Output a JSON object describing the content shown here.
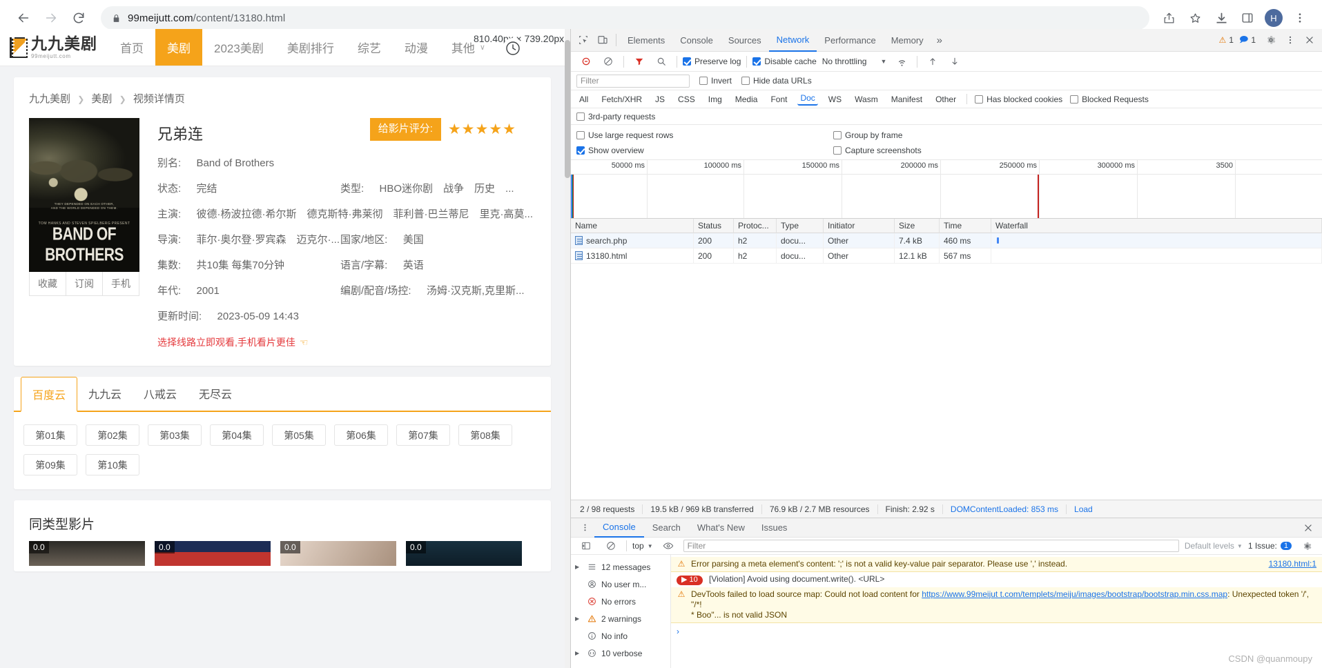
{
  "browser": {
    "url_main": "99meijutt.com",
    "url_path": "/content/13180.html",
    "back_icon": "back-arrow-icon",
    "forward_icon": "forward-arrow-icon",
    "reload_icon": "reload-icon",
    "lock_icon": "lock-icon",
    "share_icon": "share-icon",
    "bookmark_icon": "star-icon",
    "download_icon": "download-icon",
    "sidepanel_icon": "side-panel-icon",
    "profile_initial": "H",
    "menu_icon": "kebab-menu-icon"
  },
  "site": {
    "logo_cn": "九九美剧",
    "logo_en": "99meijutt.com",
    "nav": [
      {
        "label": "首页",
        "active": false
      },
      {
        "label": "美剧",
        "active": true
      },
      {
        "label": "2023美剧",
        "active": false
      },
      {
        "label": "美剧排行",
        "active": false
      },
      {
        "label": "综艺",
        "active": false
      },
      {
        "label": "动漫",
        "active": false
      },
      {
        "label": "其他",
        "active": false,
        "caret": "∨"
      }
    ]
  },
  "overlay": {
    "dimension_label": "810.40px × 739.20px",
    "clock_icon": "clock-icon"
  },
  "detail": {
    "breadcrumb": [
      "九九美剧",
      "美剧",
      "视频详情页"
    ],
    "breadcrumb_sep": "❯",
    "poster": {
      "tagline_1": "THEY DEPENDED ON EACH OTHER,",
      "tagline_2": "AND THE WORLD DEPENDED ON THEM.",
      "presents": "TOM HANKS AND STEVEN SPIELBERG PRESENT",
      "title": "BAND OF BROTHERS"
    },
    "poster_buttons": [
      "收藏",
      "订阅",
      "手机"
    ],
    "title": "兄弟连",
    "rating_label": "给影片评分:",
    "stars": "★★★★★",
    "rows": [
      {
        "left_key": "别名:",
        "left_val": "Band of Brothers",
        "full": true
      },
      {
        "left_key": "状态:",
        "left_val": "完结",
        "right_key": "类型:",
        "right_val": "HBO迷你剧　战争　历史　..."
      },
      {
        "left_key": "主演:",
        "left_val": "彼德·杨波拉德·希尔斯　德克斯特·弗莱彻　菲利普·巴兰蒂尼　里克·高莫...",
        "full": true
      },
      {
        "left_key": "导演:",
        "left_val": "菲尔·奥尔登·罗宾森　迈克尔·...",
        "right_key": "国家/地区:",
        "right_val": "美国"
      },
      {
        "left_key": "集数:",
        "left_val": "共10集 每集70分钟",
        "right_key": "语言/字幕:",
        "right_val": "英语"
      },
      {
        "left_key": "年代:",
        "left_val": "2001",
        "right_key": "编剧/配音/场控:",
        "right_val": "汤姆·汉克斯,克里斯..."
      }
    ],
    "update_key": "更新时间:",
    "update_val": "2023-05-09 14:43",
    "red_link": "选择线路立即观看,手机看片更佳",
    "hand_icon": "pointing-hand-icon"
  },
  "sources": {
    "tabs": [
      {
        "label": "百度云",
        "active": true
      },
      {
        "label": "九九云",
        "active": false
      },
      {
        "label": "八戒云",
        "active": false
      },
      {
        "label": "无尽云",
        "active": false
      }
    ],
    "episodes": [
      "第01集",
      "第02集",
      "第03集",
      "第04集",
      "第05集",
      "第06集",
      "第07集",
      "第08集",
      "第09集",
      "第10集"
    ]
  },
  "similar": {
    "title": "同类型影片",
    "items": [
      {
        "score": "0.0"
      },
      {
        "score": "0.0"
      },
      {
        "score": "0.0"
      },
      {
        "score": "0.0"
      }
    ]
  },
  "devtools": {
    "inspect_icon": "inspect-element-icon",
    "device_icon": "device-toolbar-icon",
    "tabs": [
      {
        "label": "Elements",
        "active": false
      },
      {
        "label": "Console",
        "active": false
      },
      {
        "label": "Sources",
        "active": false
      },
      {
        "label": "Network",
        "active": true
      },
      {
        "label": "Performance",
        "active": false
      },
      {
        "label": "Memory",
        "active": false
      }
    ],
    "more_tabs": "»",
    "warning_count": "1",
    "info_count": "1",
    "settings_icon": "gear-icon",
    "kebab_icon": "kebab-menu-icon",
    "close_icon": "close-icon",
    "network": {
      "record_icon": "record-stop-icon",
      "clear_icon": "clear-icon",
      "filter_icon": "filter-icon",
      "search_icon": "search-icon",
      "preserve_log": "Preserve log",
      "preserve_log_checked": true,
      "disable_cache": "Disable cache",
      "disable_cache_checked": true,
      "throttling": "No throttling",
      "wifi_icon": "wifi-icon",
      "import_icon": "import-har-icon",
      "export_icon": "export-har-icon",
      "filter_placeholder": "Filter",
      "invert": "Invert",
      "hide_data_urls": "Hide data URLs",
      "types": [
        "All",
        "Fetch/XHR",
        "JS",
        "CSS",
        "Img",
        "Media",
        "Font",
        "Doc",
        "WS",
        "Wasm",
        "Manifest",
        "Other"
      ],
      "active_type": "Doc",
      "has_blocked_cookies": "Has blocked cookies",
      "blocked_requests": "Blocked Requests",
      "third_party": "3rd-party requests",
      "large_rows": "Use large request rows",
      "group_by_frame": "Group by frame",
      "show_overview": "Show overview",
      "show_overview_checked": true,
      "capture_screenshots": "Capture screenshots",
      "overview_ticks": [
        "50000 ms",
        "100000 ms",
        "150000 ms",
        "200000 ms",
        "250000 ms",
        "300000 ms",
        "3500"
      ],
      "columns": [
        "Name",
        "Status",
        "Protoc...",
        "Type",
        "Initiator",
        "Size",
        "Time",
        "Waterfall"
      ],
      "rows": [
        {
          "name": "search.php",
          "status": "200",
          "protocol": "h2",
          "type": "docu...",
          "initiator": "Other",
          "size": "7.4 kB",
          "time": "460 ms"
        },
        {
          "name": "13180.html",
          "status": "200",
          "protocol": "h2",
          "type": "docu...",
          "initiator": "Other",
          "size": "12.1 kB",
          "time": "567 ms"
        }
      ],
      "status": {
        "requests": "2 / 98 requests",
        "transferred": "19.5 kB / 969 kB transferred",
        "resources": "76.9 kB / 2.7 MB resources",
        "finish": "Finish: 2.92 s",
        "dcl": "DOMContentLoaded: 853 ms",
        "load": "Load"
      }
    },
    "drawer": {
      "kebab_icon": "kebab-menu-icon",
      "tabs": [
        {
          "label": "Console",
          "active": true
        },
        {
          "label": "Search",
          "active": false
        },
        {
          "label": "What's New",
          "active": false
        },
        {
          "label": "Issues",
          "active": false
        }
      ],
      "close_icon": "close-icon",
      "sidebar_toggle_icon": "console-sidebar-icon",
      "clear_console_icon": "clear-console-icon",
      "context": "top",
      "eye_icon": "live-expression-icon",
      "filter_placeholder": "Filter",
      "levels": "Default levels",
      "issues_label": "1 Issue:",
      "issues_count": "1",
      "settings_icon": "gear-icon",
      "counts": [
        {
          "icon": "list-icon",
          "label": "12 messages",
          "expandable": true
        },
        {
          "icon": "user-icon",
          "label": "No user m...",
          "expandable": false
        },
        {
          "icon": "error-icon",
          "label": "No errors",
          "expandable": false
        },
        {
          "icon": "warning-icon",
          "label": "2 warnings",
          "expandable": true
        },
        {
          "icon": "info-icon",
          "label": "No info",
          "expandable": false
        },
        {
          "icon": "verbose-icon",
          "label": "10 verbose",
          "expandable": true
        }
      ],
      "messages": [
        {
          "kind": "warn",
          "icon": "warning-icon",
          "text": "Error parsing a meta element's content: ';' is not a valid key-value pair separator. Please use ',' instead.",
          "source": "13180.html:1"
        },
        {
          "kind": "violation",
          "pill": "10",
          "pill_icon": "play-triangle-icon",
          "text": "[Violation] Avoid using document.write(). <URL>"
        },
        {
          "kind": "warn2",
          "icon": "warning-icon",
          "text": "DevTools failed to load source map: Could not load content for ",
          "link": "https://www.99meijut t.com/templets/meiju/images/bootstrap/bootstrap.min.css.map",
          "text2": ": Unexpected token '/', \"/*!",
          "text3": "  * Boo\"... is not valid JSON"
        }
      ],
      "prompt": "›"
    }
  },
  "watermark": "CSDN @quanmoupy"
}
